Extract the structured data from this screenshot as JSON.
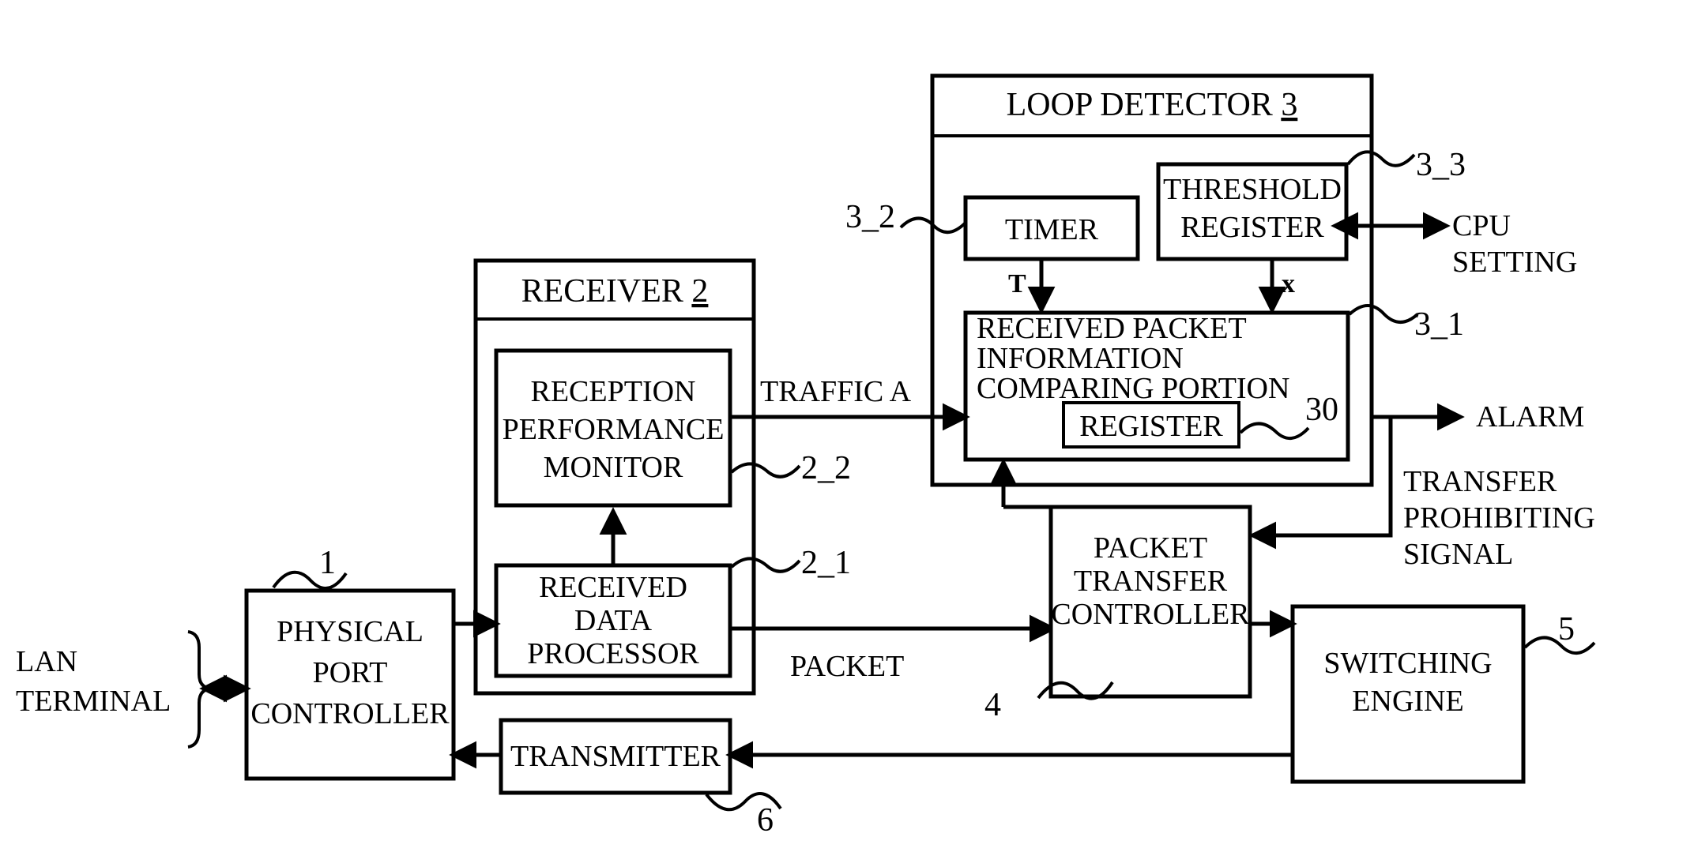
{
  "figure": {
    "type": "block-diagram",
    "background": "#ffffff",
    "line_color": "#000000"
  },
  "blocks": {
    "physical_port_controller": {
      "label_lines": [
        "PHYSICAL",
        "PORT",
        "CONTROLLER"
      ],
      "ref": "1"
    },
    "receiver": {
      "title": "RECEIVER",
      "title_ref": "2",
      "ref": "2",
      "children": {
        "reception_performance_monitor": {
          "label_lines": [
            "RECEPTION",
            "PERFORMANCE",
            "MONITOR"
          ],
          "ref": "2_2"
        },
        "received_data_processor": {
          "label_lines": [
            "RECEIVED",
            "DATA",
            "PROCESSOR"
          ],
          "ref": "2_1"
        }
      }
    },
    "loop_detector": {
      "title": "LOOP DETECTOR",
      "title_ref": "3",
      "children": {
        "timer": {
          "label": "TIMER",
          "ref": "3_2",
          "output_var": "T"
        },
        "threshold_register": {
          "label_lines": [
            "THRESHOLD",
            "REGISTER"
          ],
          "ref": "3_3",
          "output_var": "x"
        },
        "received_packet_information_comparing_portion": {
          "label_lines": [
            "RECEIVED PACKET",
            "INFORMATION",
            "COMPARING PORTION"
          ],
          "ref": "3_1",
          "inner": {
            "register": {
              "label": "REGISTER",
              "ref": "30"
            }
          }
        }
      }
    },
    "packet_transfer_controller": {
      "label_lines": [
        "PACKET",
        "TRANSFER",
        "CONTROLLER"
      ],
      "ref": "4"
    },
    "switching_engine": {
      "label_lines": [
        "SWITCHING",
        "ENGINE"
      ],
      "ref": "5"
    },
    "transmitter": {
      "label": "TRANSMITTER",
      "ref": "6"
    }
  },
  "external": {
    "lan_terminal": {
      "label_lines": [
        "LAN",
        "TERMINAL"
      ]
    },
    "cpu_setting": {
      "label_lines": [
        "CPU",
        "SETTING"
      ]
    },
    "alarm": {
      "label": "ALARM"
    }
  },
  "signals": {
    "traffic_a": "TRAFFIC A",
    "packet": "PACKET",
    "transfer_prohibiting_signal_lines": [
      "TRANSFER",
      "PROHIBITING",
      "SIGNAL"
    ],
    "timer_out": "T",
    "threshold_out": "x"
  }
}
